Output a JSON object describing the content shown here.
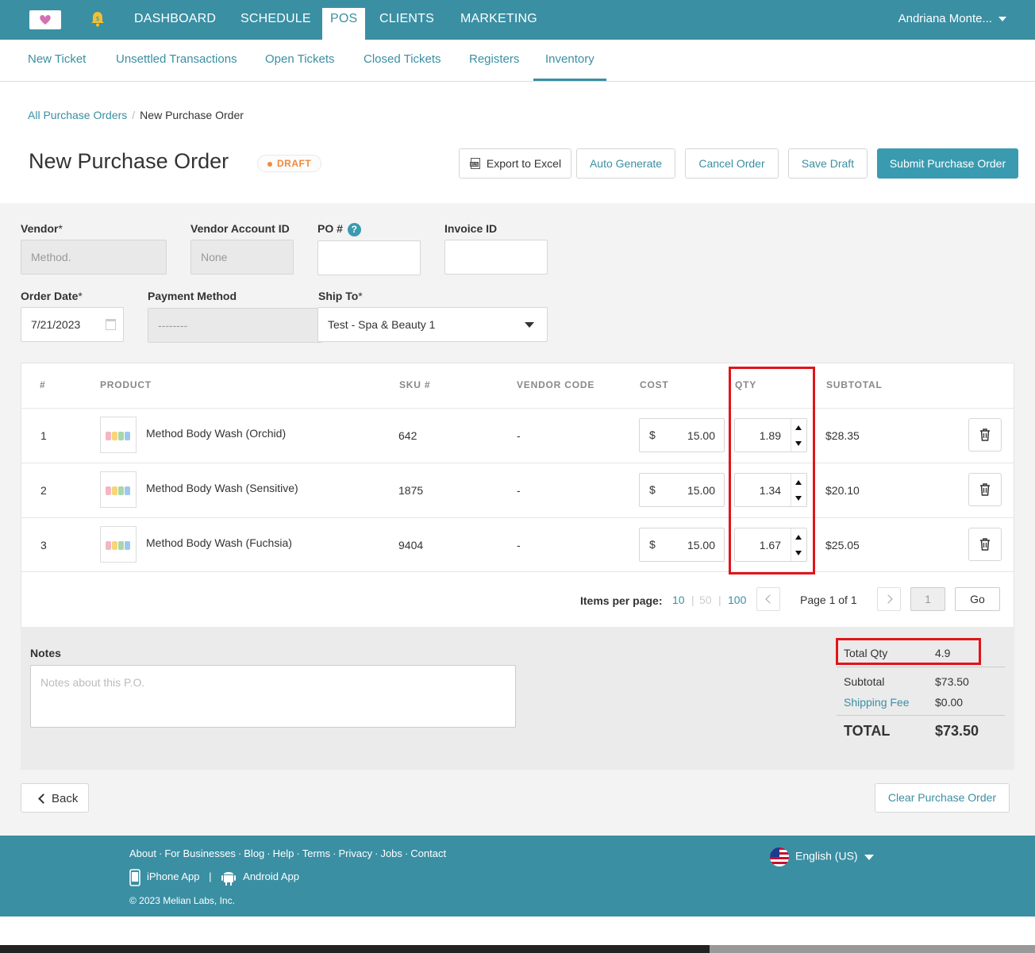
{
  "topnav": {
    "items": [
      "DASHBOARD",
      "SCHEDULE",
      "POS",
      "CLIENTS",
      "MARKETING"
    ],
    "active": "POS",
    "user": "Andriana Monte..."
  },
  "subnav": {
    "items": [
      "New Ticket",
      "Unsettled Transactions",
      "Open Tickets",
      "Closed Tickets",
      "Registers",
      "Inventory"
    ],
    "active": "Inventory"
  },
  "breadcrumb": {
    "parent": "All Purchase Orders",
    "separator": "/",
    "current": "New Purchase Order"
  },
  "page": {
    "title": "New Purchase Order",
    "status": "DRAFT"
  },
  "actions": {
    "export": "Export to Excel",
    "auto": "Auto Generate",
    "cancel": "Cancel Order",
    "save": "Save Draft",
    "submit": "Submit Purchase Order"
  },
  "form": {
    "vendor_label": "Vendor",
    "vendor_value": "Method.",
    "vendor_account_label": "Vendor Account ID",
    "vendor_account_value": "None",
    "po_label": "PO #",
    "po_help": "?",
    "invoice_label": "Invoice ID",
    "order_date_label": "Order Date",
    "order_date_value": "7/21/2023",
    "payment_label": "Payment Method",
    "payment_value": "--------",
    "ship_label": "Ship To",
    "ship_value": "Test - Spa & Beauty 1",
    "required_mark": "*"
  },
  "table": {
    "headers": [
      "#",
      "PRODUCT",
      "SKU #",
      "VENDOR CODE",
      "COST",
      "QTY",
      "SUBTOTAL"
    ],
    "rows": [
      {
        "num": "1",
        "product": "Method Body Wash (Orchid)",
        "sku": "642",
        "vendor_code": "-",
        "currency": "$",
        "cost": "15.00",
        "qty": "1.89",
        "subtotal": "$28.35"
      },
      {
        "num": "2",
        "product": "Method Body Wash (Sensitive)",
        "sku": "1875",
        "vendor_code": "-",
        "currency": "$",
        "cost": "15.00",
        "qty": "1.34",
        "subtotal": "$20.10"
      },
      {
        "num": "3",
        "product": "Method Body Wash (Fuchsia)",
        "sku": "9404",
        "vendor_code": "-",
        "currency": "$",
        "cost": "15.00",
        "qty": "1.67",
        "subtotal": "$25.05"
      }
    ]
  },
  "pager": {
    "label": "Items per page:",
    "options": [
      "10",
      "50",
      "100"
    ],
    "separator": "|",
    "page_text": "Page 1 of 1",
    "page_value": "1",
    "go": "Go"
  },
  "notes": {
    "label": "Notes",
    "placeholder": "Notes about this P.O."
  },
  "summary": {
    "total_qty_label": "Total Qty",
    "total_qty": "4.9",
    "subtotal_label": "Subtotal",
    "subtotal": "$73.50",
    "shipping_label": "Shipping Fee",
    "shipping": "$0.00",
    "total_label": "TOTAL",
    "total": "$73.50"
  },
  "bottom": {
    "back": "Back",
    "clear": "Clear Purchase Order"
  },
  "footer": {
    "links": [
      "About",
      "For Businesses",
      "Blog",
      "Help",
      "Terms",
      "Privacy",
      "Jobs",
      "Contact"
    ],
    "link_sep": "·",
    "iphone": "iPhone App",
    "app_sep": "|",
    "android": "Android App",
    "copyright": "© 2023 Melian Labs, Inc.",
    "language": "English (US)"
  },
  "colors": {
    "brand": "#3a8fa3",
    "button_primary": "#3a9bb0",
    "draft": "#f0893b",
    "highlight": "#e0151b"
  }
}
